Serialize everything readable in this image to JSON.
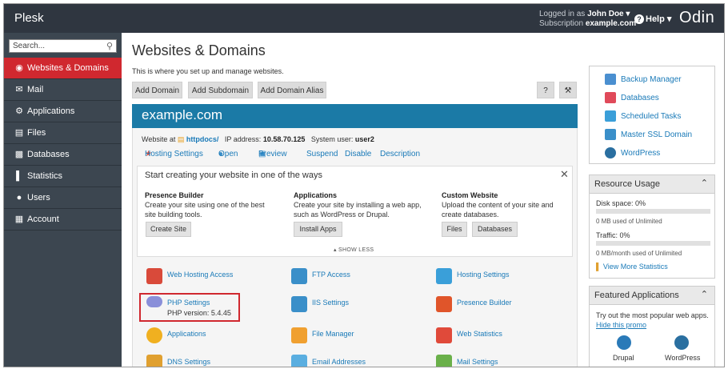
{
  "topbar": {
    "brand": "Plesk",
    "logged_in_label": "Logged in as",
    "user": "John Doe ▾",
    "subscription_label": "Subscription",
    "subscription": "example.com",
    "help": "Help ▾",
    "logo_text": "Odin"
  },
  "sidebar": {
    "search_placeholder": "Search...",
    "items": [
      {
        "label": "Websites & Domains",
        "icon": "globe-icon"
      },
      {
        "label": "Mail",
        "icon": "mail-icon"
      },
      {
        "label": "Applications",
        "icon": "gear-icon"
      },
      {
        "label": "Files",
        "icon": "folder-icon"
      },
      {
        "label": "Databases",
        "icon": "database-icon"
      },
      {
        "label": "Statistics",
        "icon": "bar-chart-icon"
      },
      {
        "label": "Users",
        "icon": "user-icon"
      },
      {
        "label": "Account",
        "icon": "account-icon"
      }
    ]
  },
  "main": {
    "title": "Websites & Domains",
    "subtitle": "This is where you set up and manage websites.",
    "toolbar": [
      "Add Domain",
      "Add Subdomain",
      "Add Domain Alias"
    ],
    "help_btn": "?",
    "domain": {
      "name": "example.com",
      "website_at_label": "Website at",
      "docroot": "httpdocs/",
      "ip_label": "IP address:",
      "ip": "10.58.70.125",
      "sysuser_label": "System user:",
      "sysuser": "user2",
      "links": [
        "Hosting Settings",
        "Open",
        "Preview",
        "Suspend",
        "Disable",
        "Description"
      ]
    },
    "start": {
      "title": "Start creating your website in one of the ways",
      "cols": [
        {
          "heading": "Presence Builder",
          "text": "Create your site using one of the best site building tools.",
          "buttons": [
            "Create Site"
          ]
        },
        {
          "heading": "Applications",
          "text": "Create your site by installing a web app, such as WordPress or Drupal.",
          "buttons": [
            "Install Apps"
          ]
        },
        {
          "heading": "Custom Website",
          "text": "Upload the content of your site and create databases.",
          "buttons": [
            "Files",
            "Databases"
          ]
        }
      ],
      "show_less": "▴ SHOW LESS"
    },
    "tools": [
      {
        "label": "Web Hosting Access",
        "color": "#d94a3a"
      },
      {
        "label": "FTP Access",
        "color": "#3a8fc9"
      },
      {
        "label": "Hosting Settings",
        "color": "#3a9fd9"
      },
      {
        "label": "PHP Settings",
        "color": "#8a8fd9",
        "sub": "PHP version: 5.4.45"
      },
      {
        "label": "IIS Settings",
        "color": "#3a8fc9"
      },
      {
        "label": "Presence Builder",
        "color": "#e0552a"
      },
      {
        "label": "Applications",
        "color": "#f0b020"
      },
      {
        "label": "File Manager",
        "color": "#f0a030"
      },
      {
        "label": "Web Statistics",
        "color": "#e04a3a"
      },
      {
        "label": "DNS Settings",
        "color": "#e0a030"
      },
      {
        "label": "Email Addresses",
        "color": "#5aaee0"
      },
      {
        "label": "Mail Settings",
        "color": "#6ab04a"
      }
    ]
  },
  "right": {
    "quick_links": [
      {
        "label": "Backup Manager",
        "color": "#4a8fd0"
      },
      {
        "label": "Databases",
        "color": "#e04a5a"
      },
      {
        "label": "Scheduled Tasks",
        "color": "#3a9fd9"
      },
      {
        "label": "Master SSL Domain",
        "color": "#3a8fc9"
      },
      {
        "label": "WordPress",
        "color": "#2a6fa0"
      }
    ],
    "resource": {
      "title": "Resource Usage",
      "disk_label": "Disk space: 0%",
      "disk_used": "0 MB used of Unlimited",
      "disk_pct": 0,
      "traffic_label": "Traffic: 0%",
      "traffic_used": "0 MB/month used of Unlimited",
      "traffic_pct": 0,
      "more": "View More Statistics"
    },
    "featured": {
      "title": "Featured Applications",
      "text": "Try out the most popular web apps.",
      "hide": "Hide this promo",
      "apps": [
        "Drupal",
        "WordPress"
      ]
    }
  },
  "colors": {
    "topbar": "#2f3640",
    "sidebar": "#3c4650",
    "active": "#d0282f",
    "domain_head": "#1b7aa6",
    "link": "#1a7ab8"
  }
}
